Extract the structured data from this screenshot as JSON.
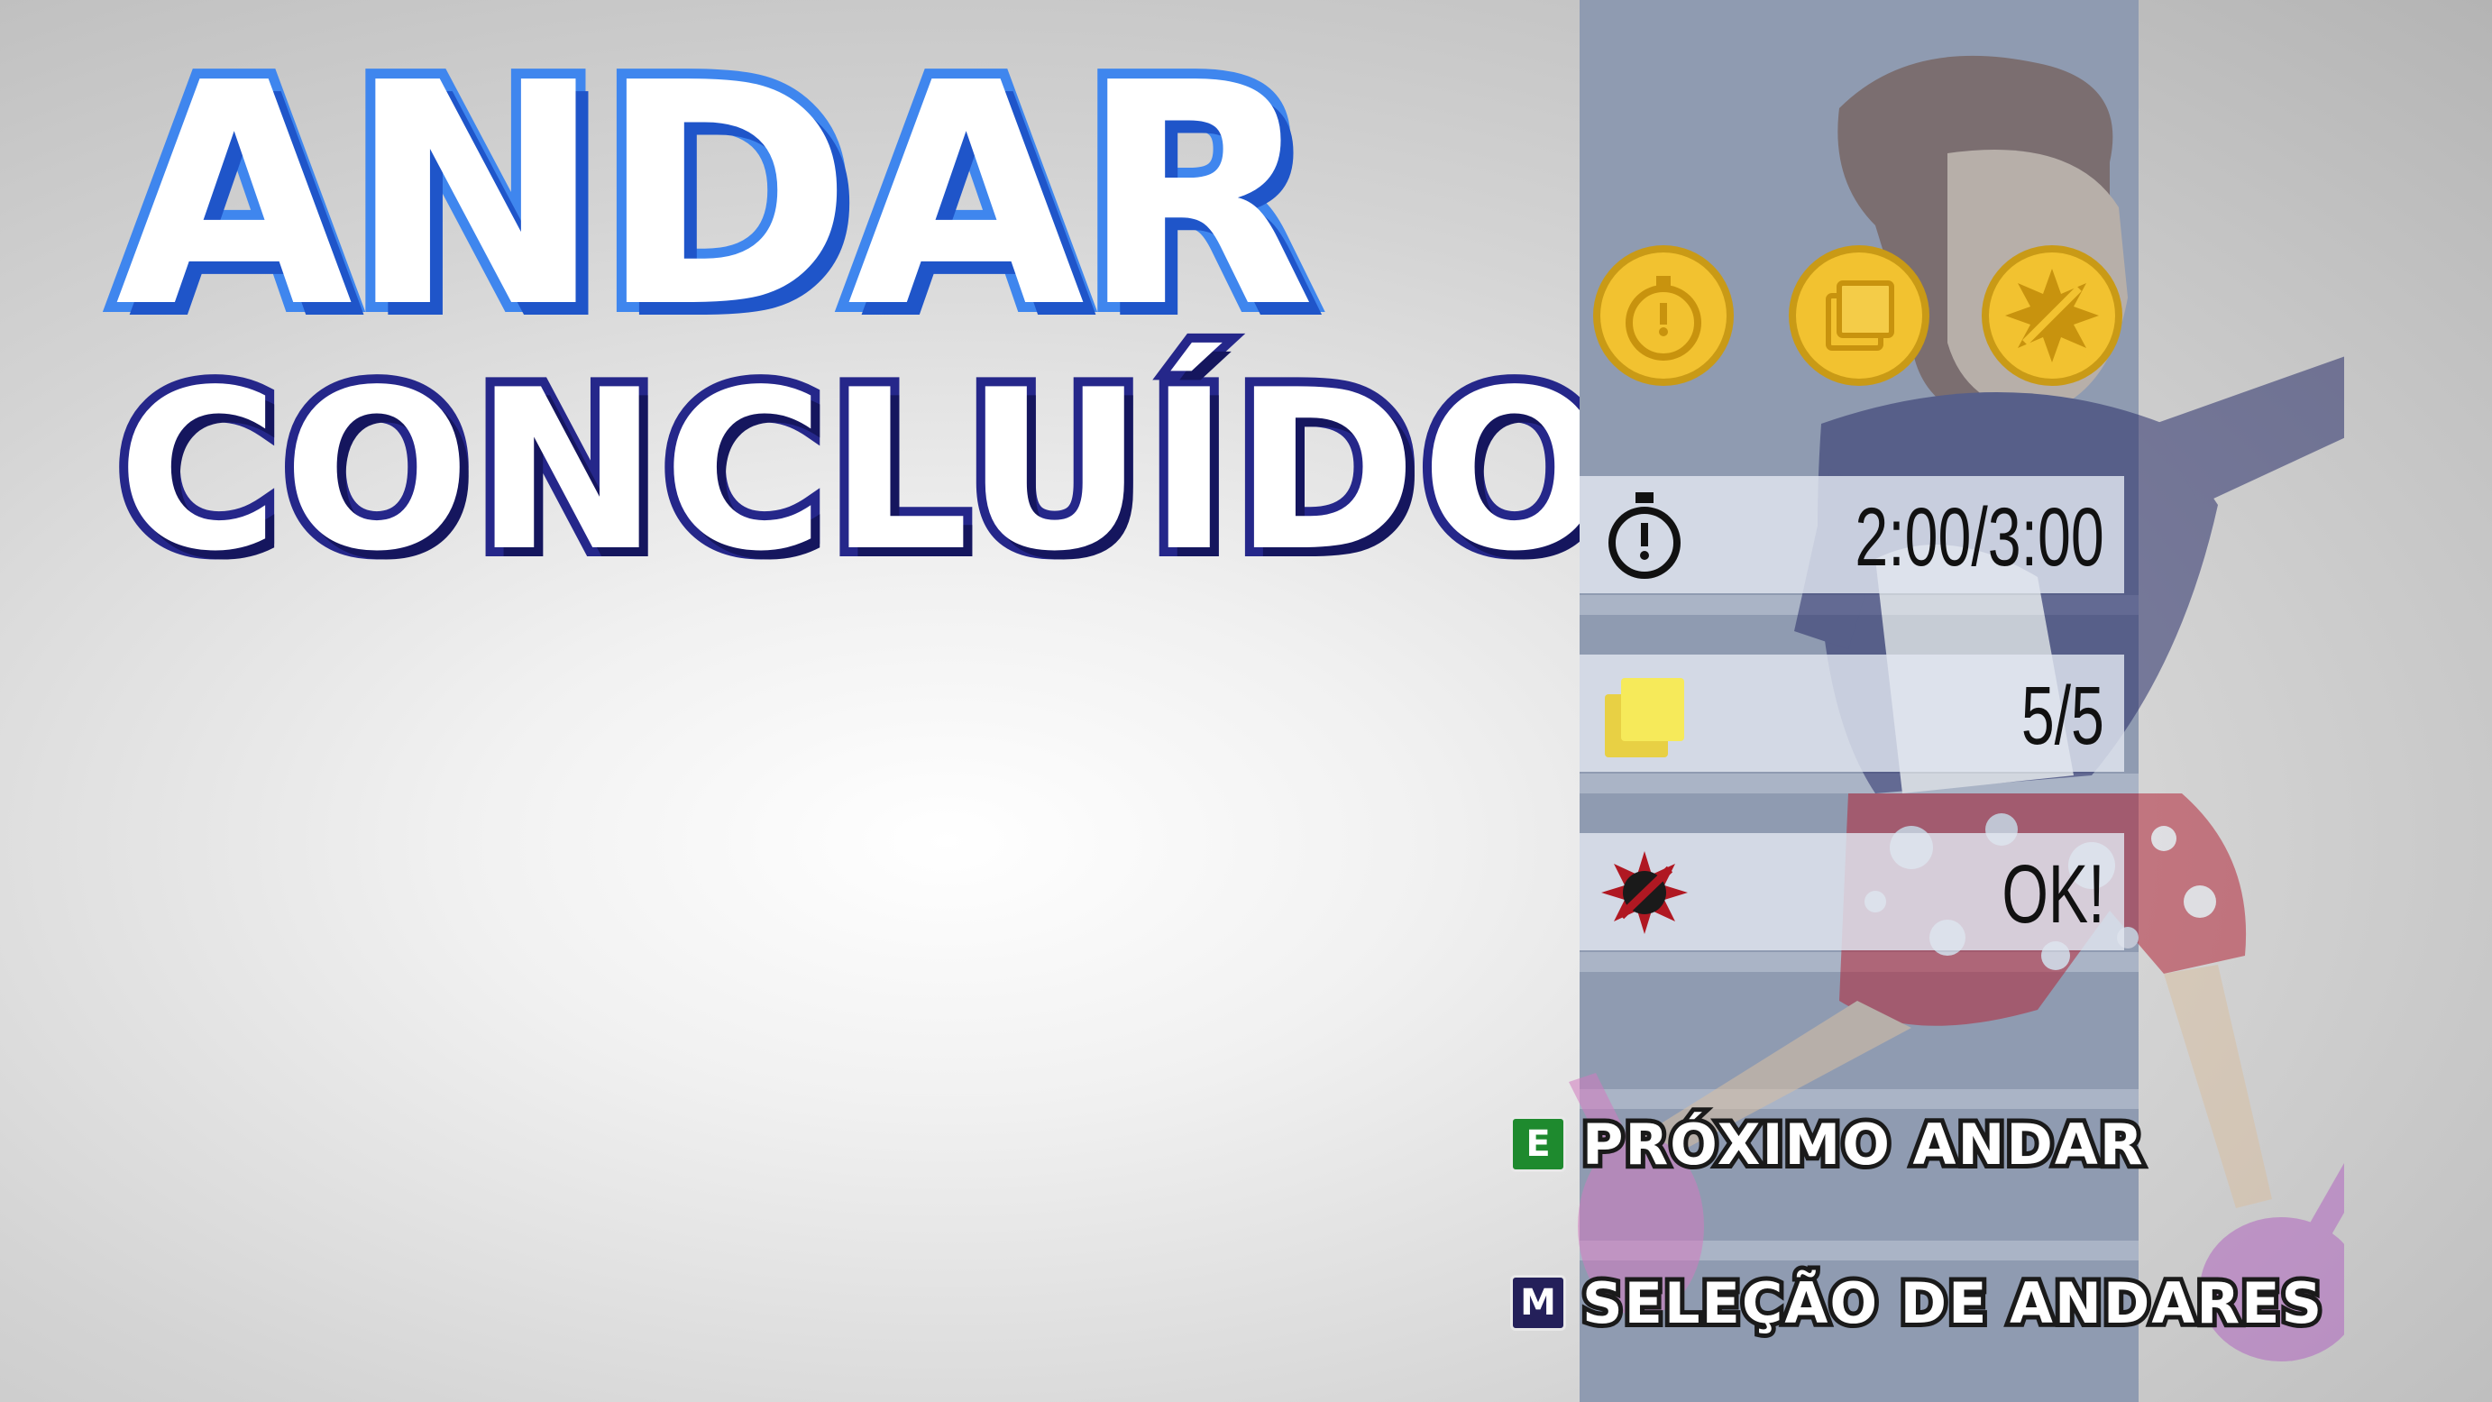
{
  "title": {
    "line1": "ANDAR",
    "line2": "CONCLUÍDO"
  },
  "medals": [
    {
      "name": "time-medal",
      "earned": true
    },
    {
      "name": "notes-medal",
      "earned": true
    },
    {
      "name": "bug-medal",
      "earned": true
    }
  ],
  "stats": [
    {
      "icon": "stopwatch-icon",
      "value": "2:00/3:00"
    },
    {
      "icon": "sticky-notes-icon",
      "value": "5/5"
    },
    {
      "icon": "no-bug-icon",
      "value": "OK!"
    }
  ],
  "menu": [
    {
      "key": "E",
      "label": "PRÓXIMO ANDAR",
      "key_color": "#1e8a2e"
    },
    {
      "key": "M",
      "label": "SELEÇÃO DE ANDARES",
      "key_color": "#24205a"
    }
  ],
  "colors": {
    "title_outline": "#3f86ee",
    "subtitle_outline": "#25278a",
    "panel": "#8f9bb1",
    "medal_gold": "#f2c230"
  }
}
